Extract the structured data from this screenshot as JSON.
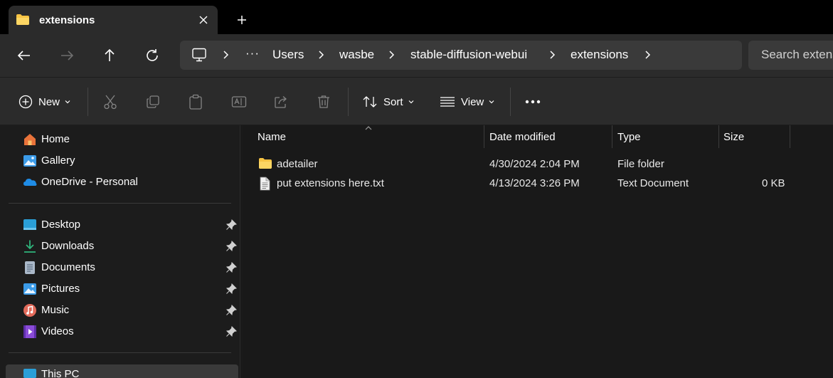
{
  "tab": {
    "title": "extensions",
    "close_icon": "close-icon",
    "new_tab_icon": "plus-icon"
  },
  "breadcrumb": {
    "overflow": "···",
    "items": [
      "Users",
      "wasbe",
      "stable-diffusion-webui",
      "extensions"
    ]
  },
  "search": {
    "placeholder": "Search extensions"
  },
  "commands": {
    "new": "New",
    "sort": "Sort",
    "view": "View",
    "more": "•••"
  },
  "sidebar": {
    "top": [
      {
        "label": "Home",
        "icon": "home-icon"
      },
      {
        "label": "Gallery",
        "icon": "gallery-icon"
      },
      {
        "label": "OneDrive - Personal",
        "icon": "cloud-icon"
      }
    ],
    "pinned": [
      {
        "label": "Desktop",
        "icon": "desktop-icon"
      },
      {
        "label": "Downloads",
        "icon": "download-icon"
      },
      {
        "label": "Documents",
        "icon": "document-icon"
      },
      {
        "label": "Pictures",
        "icon": "pictures-icon"
      },
      {
        "label": "Music",
        "icon": "music-icon"
      },
      {
        "label": "Videos",
        "icon": "videos-icon"
      }
    ],
    "bottom": [
      {
        "label": "This PC",
        "icon": "this-pc-icon"
      }
    ]
  },
  "columns": {
    "name": "Name",
    "date": "Date modified",
    "type": "Type",
    "size": "Size"
  },
  "files": [
    {
      "name": "adetailer",
      "date": "4/30/2024 2:04 PM",
      "type": "File folder",
      "size": "",
      "icon": "folder-icon"
    },
    {
      "name": "put extensions here.txt",
      "date": "4/13/2024 3:26 PM",
      "type": "Text Document",
      "size": "0 KB",
      "icon": "text-file-icon"
    }
  ],
  "colors": {
    "accent": "#4cc2ff",
    "folder": "#f8c444"
  }
}
